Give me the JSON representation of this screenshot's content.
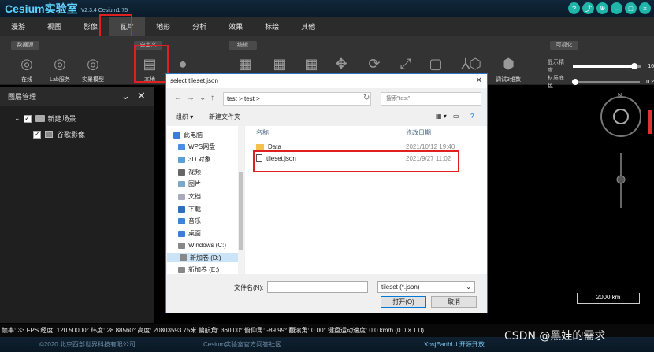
{
  "app": {
    "title": "Cesium实验室",
    "version": "V2.3.4  Cesium1.75",
    "window_controls": [
      "?",
      "⤴",
      "⊕",
      "–",
      "□",
      "×"
    ]
  },
  "menu": {
    "items": [
      "漫游",
      "视图",
      "影像",
      "瓦片",
      "地形",
      "分析",
      "效果",
      "标绘",
      "其他"
    ],
    "active": "瓦片"
  },
  "ribbon": {
    "groups": {
      "datasource": "数据源",
      "custom": "自定义",
      "edit": "编辑",
      "visual": "可视化"
    },
    "buttons": {
      "online": "在线",
      "lab_service": "Lab服务",
      "real_model": "实景模型",
      "local": "本地",
      "debug_panel": "调试3维数"
    },
    "sliders": {
      "display_precision": {
        "label": "显示精度",
        "value": "16",
        "level": 0.82
      },
      "material_base": {
        "label": "材质底色",
        "value": "0.2",
        "level": 0.05
      }
    }
  },
  "layer_panel": {
    "title": "图层管理",
    "tree": {
      "root": "新建场景",
      "child": "谷歌影像"
    }
  },
  "globe": {
    "compass_n": "N",
    "scale": "2000 km"
  },
  "status": {
    "text": "帧率: 33 FPS 经度: 120.50000° 纬度: 28.88560° 高度: 20803593.75米 偏航角: 360.00° 俯仰角: -89.99° 翻滚角: 0.00° 键盘运动速度: 0.0 km/h (0.0 × 1.0)"
  },
  "footer": {
    "copyright": "©2020 北京西部世界科技有限公司",
    "community": "Cesium实验室官方问答社区",
    "xbsj": "XbsjEarthUI 开源开放"
  },
  "watermark": "CSDN @黑娃的需求",
  "dialog": {
    "title": "select tileset.json",
    "address": "test  >  test  >",
    "search_placeholder": "搜索\"test\"",
    "organize": "组织 ▾",
    "new_folder": "新建文件夹",
    "nav_items": [
      "此电脑",
      "WPS网盘",
      "3D 对象",
      "视频",
      "图片",
      "文档",
      "下载",
      "音乐",
      "桌面",
      "Windows (C:)",
      "新加卷 (D:)",
      "新加卷 (E:)"
    ],
    "columns": {
      "name": "名称",
      "modified": "修改日期"
    },
    "files": [
      {
        "name": "Data",
        "date": "2021/10/12 19:40",
        "kind": "folder"
      },
      {
        "name": "tileset.json",
        "date": "2021/9/27 11:02",
        "kind": "file"
      }
    ],
    "filename_label": "文件名(N):",
    "filename_value": "",
    "filetype": "tileset (*.json)",
    "open_button": "打开(O)",
    "cancel_button": "取消"
  }
}
